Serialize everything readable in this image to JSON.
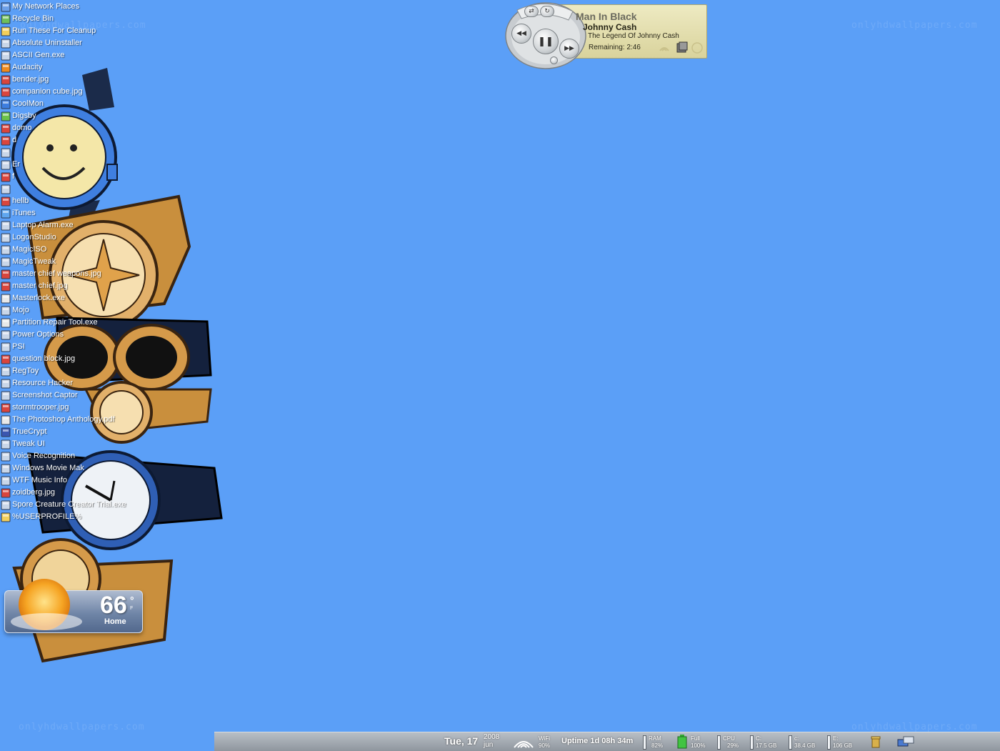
{
  "watermark": "onlyhdwallpapers.com",
  "desktop_icons": [
    {
      "label": "My Network Places",
      "icon": "network-places-icon"
    },
    {
      "label": "Recycle Bin",
      "icon": "recycle-bin-icon"
    },
    {
      "label": "Run These For Cleanup",
      "icon": "folder-icon"
    },
    {
      "label": "Absolute Uninstaller",
      "icon": "uninstaller-icon"
    },
    {
      "label": "ASCII Gen.exe",
      "icon": "ascii-gen-icon"
    },
    {
      "label": "Audacity",
      "icon": "audacity-icon"
    },
    {
      "label": "bender.jpg",
      "icon": "image-file-icon"
    },
    {
      "label": "companion cube.jpg",
      "icon": "image-file-icon"
    },
    {
      "label": "CoolMon",
      "icon": "coolmon-icon"
    },
    {
      "label": "Digsby",
      "icon": "digsby-icon"
    },
    {
      "label": "domo",
      "icon": "image-file-icon"
    },
    {
      "label": "d",
      "icon": "image-file-icon"
    },
    {
      "label": "",
      "icon": "app-icon"
    },
    {
      "label": "Er",
      "icon": "app-icon"
    },
    {
      "label": "f",
      "icon": "image-file-icon"
    },
    {
      "label": "",
      "icon": "app-icon"
    },
    {
      "label": "hellb",
      "icon": "image-file-icon"
    },
    {
      "label": "iTunes",
      "icon": "itunes-icon"
    },
    {
      "label": "Laptop Alarm.exe",
      "icon": "alarm-icon"
    },
    {
      "label": "LogonStudio",
      "icon": "logonstudio-icon"
    },
    {
      "label": "MagicISO",
      "icon": "magiciso-icon"
    },
    {
      "label": "MagicTweak",
      "icon": "magictweak-icon"
    },
    {
      "label": "master chief weapons.jpg",
      "icon": "image-file-icon"
    },
    {
      "label": "master chief.jpg",
      "icon": "image-file-icon"
    },
    {
      "label": "Masterlock.exe",
      "icon": "exe-icon"
    },
    {
      "label": "Mojo",
      "icon": "mojo-icon"
    },
    {
      "label": "Partition Repair Tool.exe",
      "icon": "exe-icon"
    },
    {
      "label": "Power Options",
      "icon": "power-options-icon"
    },
    {
      "label": "PSI",
      "icon": "psi-icon"
    },
    {
      "label": "question block.jpg",
      "icon": "image-file-icon"
    },
    {
      "label": "RegToy",
      "icon": "regtoy-icon"
    },
    {
      "label": "Resource Hacker",
      "icon": "resource-hacker-icon"
    },
    {
      "label": "Screenshot Captor",
      "icon": "screenshot-captor-icon"
    },
    {
      "label": "stormtrooper.jpg",
      "icon": "image-file-icon"
    },
    {
      "label": "The Photoshop Anthology.pdf",
      "icon": "pdf-icon"
    },
    {
      "label": "TrueCrypt",
      "icon": "truecrypt-icon"
    },
    {
      "label": "Tweak UI",
      "icon": "tweakui-icon"
    },
    {
      "label": "Voice Recognition",
      "icon": "voice-recognition-icon"
    },
    {
      "label": "Windows Movie Mak",
      "icon": "movie-maker-icon"
    },
    {
      "label": "WTF Music Info",
      "icon": "music-info-icon"
    },
    {
      "label": "zoidberg.jpg",
      "icon": "image-file-icon"
    },
    {
      "label": "Spore Creature Creator Trial.exe",
      "icon": "spore-icon"
    },
    {
      "label": "%USERPROFILE%",
      "icon": "folder-icon"
    }
  ],
  "player": {
    "song": "Man In Black",
    "artist": "Johnny Cash",
    "album": "The Legend Of Johnny Cash",
    "remaining": "Remaining: 2:46",
    "controls": {
      "prev": "◀◀",
      "play_pause": "❚❚",
      "next": "▶▶"
    }
  },
  "weather": {
    "temperature": "66",
    "unit_symbol": "°",
    "unit_letter": "F",
    "location": "Home"
  },
  "sysbar": {
    "day": "Tue, 17",
    "year": "2008",
    "month": "jun",
    "wifi_label": "WiFi",
    "wifi_value": "90%",
    "uptime": "Uptime 1d 08h 34m",
    "ram_label": "RAM",
    "ram_value": "82%",
    "battery_label": "Full",
    "battery_value": "100%",
    "cpu_label": "CPU",
    "cpu_value": "29%",
    "drive_c_label": "C:",
    "drive_c_value": "17.5 GB",
    "drive_c2_label": "c:",
    "drive_c2_value": "38.4 GB",
    "drive_e_label": "E:",
    "drive_e_value": "106 GB"
  }
}
